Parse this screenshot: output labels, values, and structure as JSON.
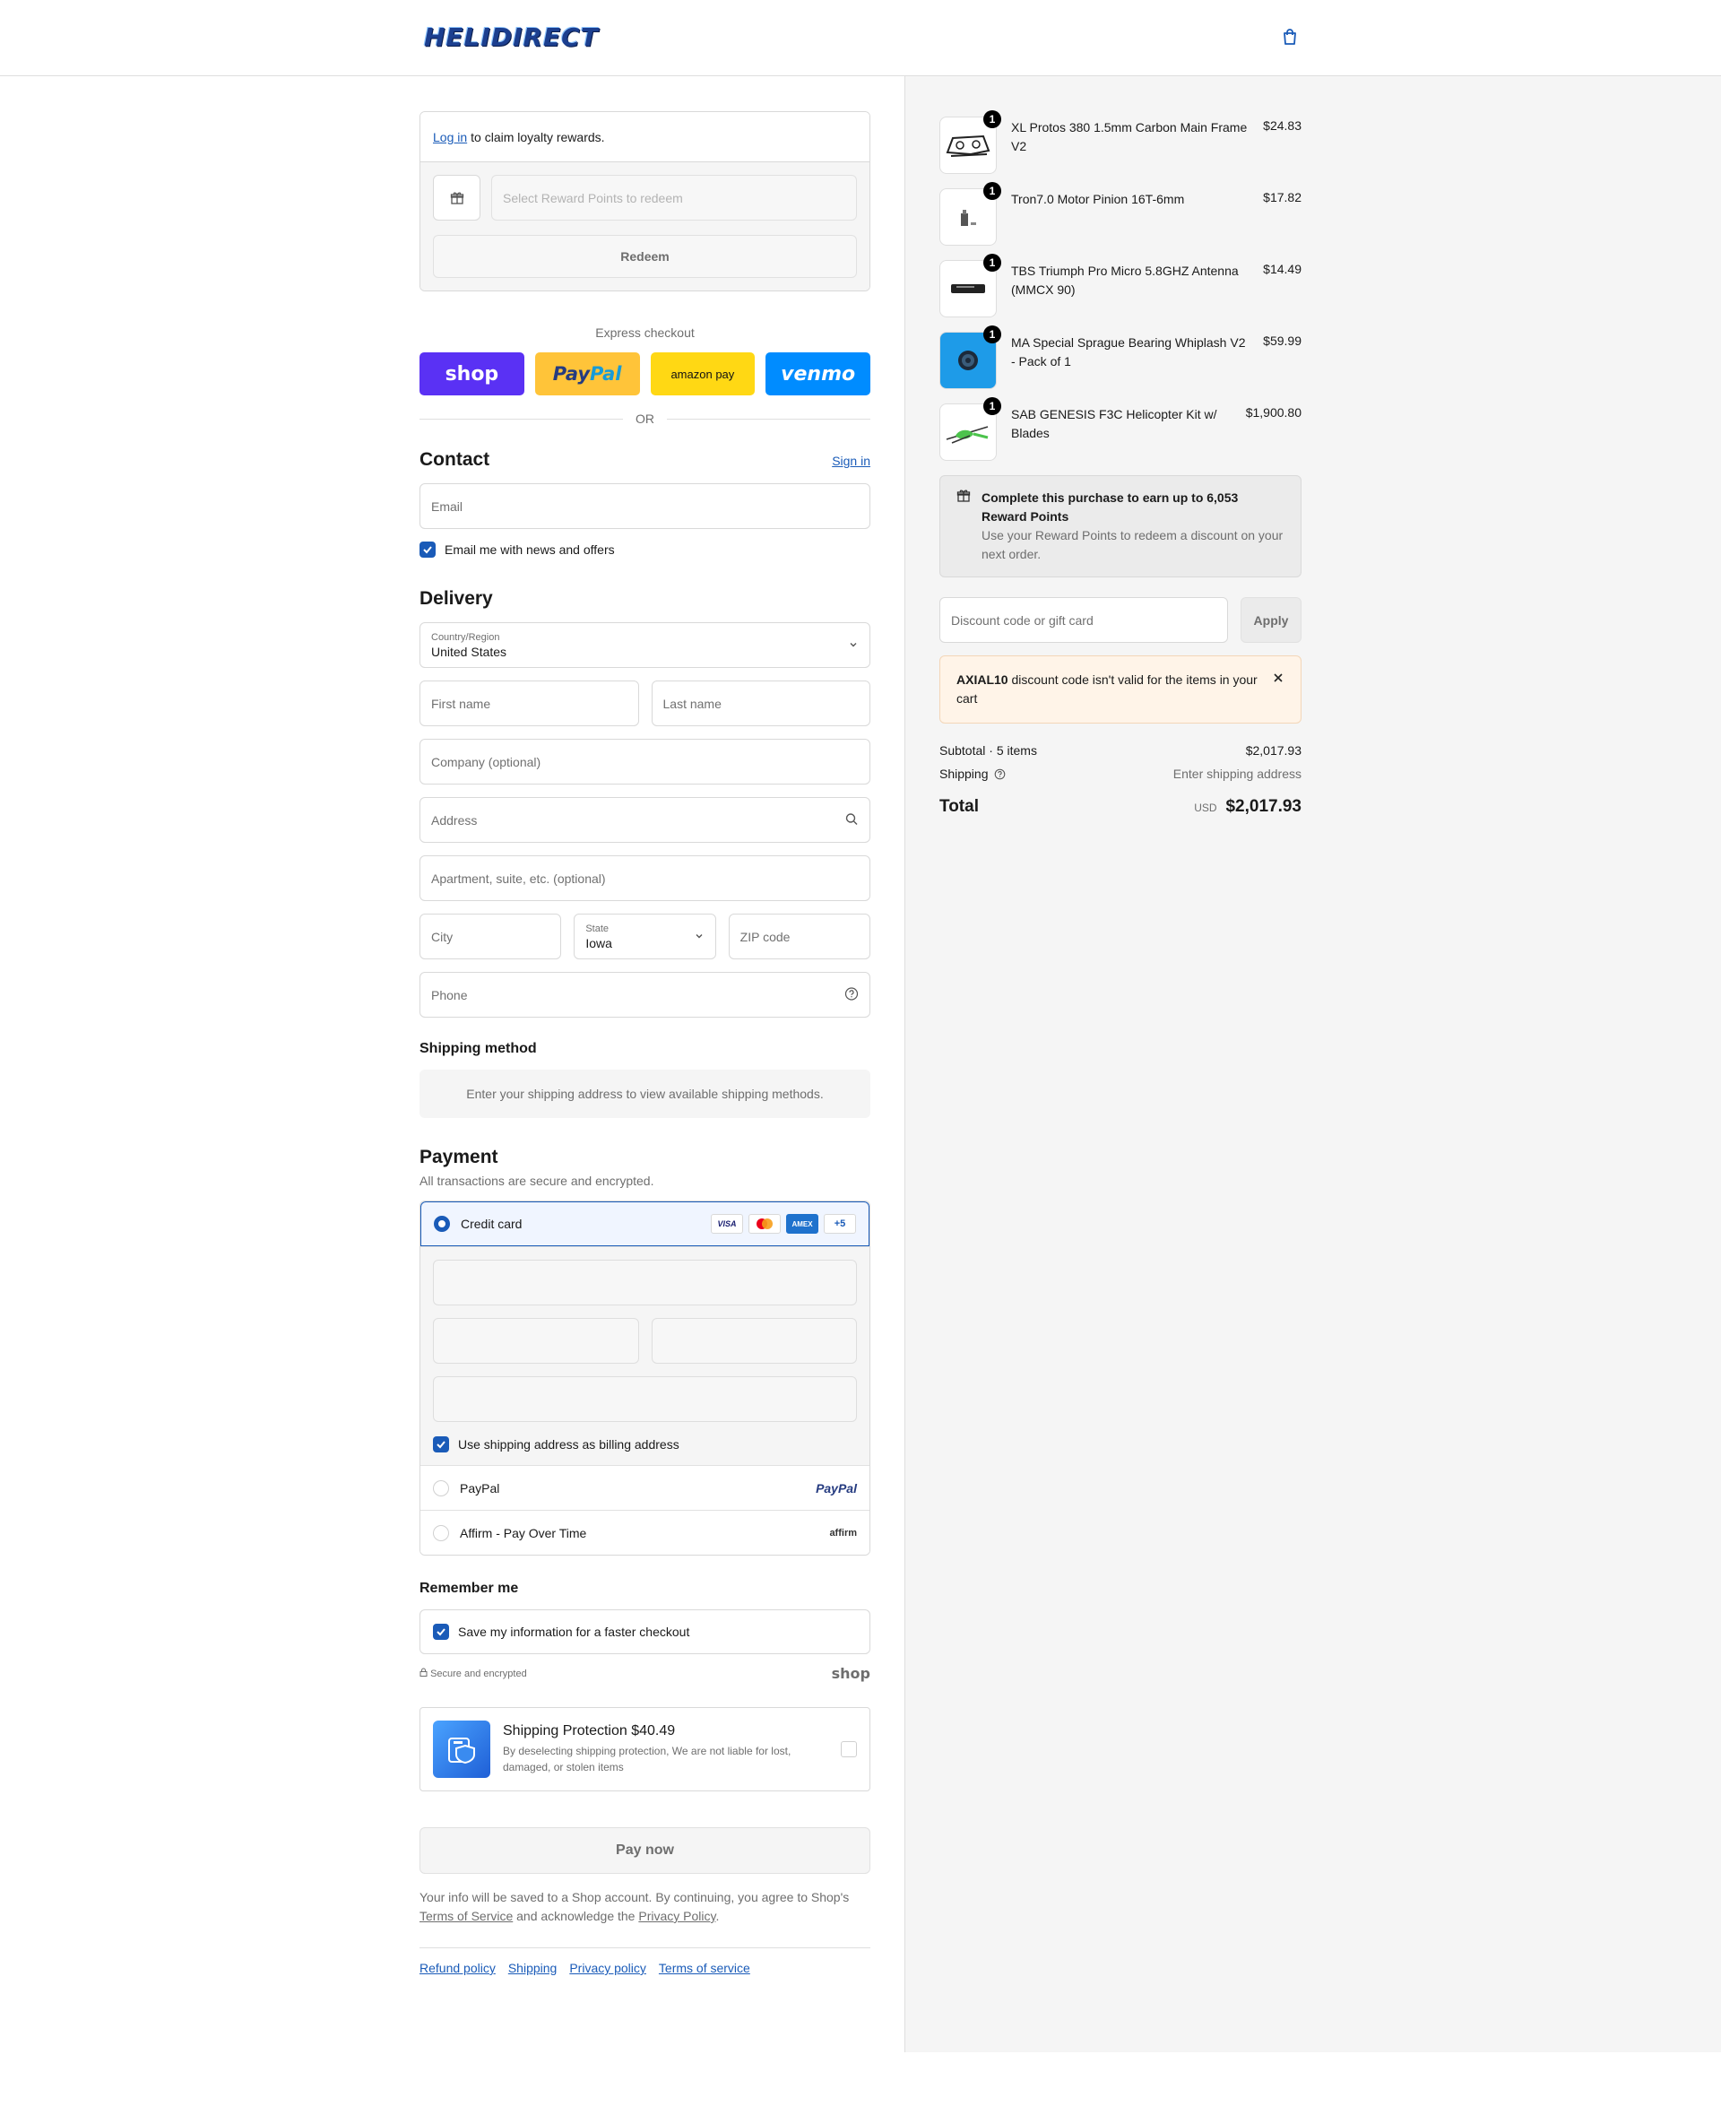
{
  "header": {
    "logo_text": "HELIDIRECT",
    "cart_icon": "shopping-bag-icon"
  },
  "loyalty": {
    "login_link": "Log in",
    "login_suffix": "to claim loyalty rewards.",
    "select_placeholder": "Select Reward Points to redeem",
    "redeem_label": "Redeem"
  },
  "express": {
    "label": "Express checkout",
    "shop": "shop",
    "paypal_1": "Pay",
    "paypal_2": "Pal",
    "amazon": "amazon pay",
    "venmo": "venmo",
    "or": "OR"
  },
  "contact": {
    "title": "Contact",
    "signin": "Sign in",
    "email_placeholder": "Email",
    "news_label": "Email me with news and offers",
    "news_checked": true
  },
  "delivery": {
    "title": "Delivery",
    "country_label": "Country/Region",
    "country_value": "United States",
    "first_name": "First name",
    "last_name": "Last name",
    "company": "Company (optional)",
    "address": "Address",
    "apartment": "Apartment, suite, etc. (optional)",
    "city": "City",
    "state_label": "State",
    "state_value": "Iowa",
    "zip": "ZIP code",
    "phone": "Phone"
  },
  "shipping_method": {
    "title": "Shipping method",
    "message": "Enter your shipping address to view available shipping methods."
  },
  "payment": {
    "title": "Payment",
    "subtitle": "All transactions are secure and encrypted.",
    "credit_card": "Credit card",
    "cards": [
      "VISA",
      "MC",
      "AMEX",
      "+5"
    ],
    "billing_label": "Use shipping address as billing address",
    "paypal": "PayPal",
    "paypal_logo": "PayPal",
    "affirm": "Affirm - Pay Over Time",
    "affirm_logo": "affirm"
  },
  "remember": {
    "title": "Remember me",
    "save_label": "Save my information for a faster checkout",
    "secure": "Secure and encrypted",
    "shop": "shop"
  },
  "protection": {
    "title": "Shipping Protection $40.49",
    "desc": "By deselecting shipping protection, We are not liable for lost, damaged, or stolen items"
  },
  "pay_now": "Pay now",
  "legal": {
    "part1": "Your info will be saved to a Shop account. By continuing, you agree to Shop's",
    "tos": "Terms of Service",
    "part2": "and acknowledge the",
    "privacy": "Privacy Policy",
    "part3": "."
  },
  "footer": [
    "Refund policy",
    "Shipping",
    "Privacy policy",
    "Terms of service"
  ],
  "items": [
    {
      "name": "XL Protos 380 1.5mm Carbon Main Frame V2",
      "price": "$24.83",
      "qty": "1"
    },
    {
      "name": "Tron7.0 Motor Pinion 16T-6mm",
      "price": "$17.82",
      "qty": "1"
    },
    {
      "name": "TBS Triumph Pro Micro 5.8GHZ Antenna (MMCX 90)",
      "price": "$14.49",
      "qty": "1"
    },
    {
      "name": "MA Special Sprague Bearing Whiplash V2 - Pack of 1",
      "price": "$59.99",
      "qty": "1"
    },
    {
      "name": "SAB GENESIS F3C Helicopter Kit w/ Blades",
      "price": "$1,900.80",
      "qty": "1"
    }
  ],
  "rewards": {
    "title": "Complete this purchase to earn up to 6,053 Reward Points",
    "desc": "Use your Reward Points to redeem a discount on your next order."
  },
  "discount": {
    "placeholder": "Discount code or gift card",
    "apply": "Apply",
    "error_code": "AXIAL10",
    "error_msg": "discount code isn't valid for the items in your cart"
  },
  "summary": {
    "subtotal_label": "Subtotal · 5 items",
    "subtotal": "$2,017.93",
    "shipping_label": "Shipping",
    "shipping_value": "Enter shipping address",
    "total_label": "Total",
    "currency": "USD",
    "total": "$2,017.93"
  },
  "colors": {
    "accent": "#1a5bb8",
    "shop": "#5a31f4",
    "paypal": "#ffc439",
    "amazon": "#ffd814",
    "venmo": "#008cff"
  }
}
